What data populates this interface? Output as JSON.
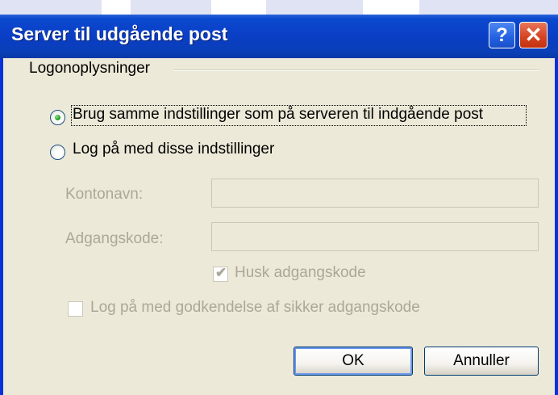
{
  "window": {
    "title": "Server til udgående post",
    "help_glyph": "?",
    "close_glyph": "✕"
  },
  "group": {
    "label": "Logonoplysninger"
  },
  "radios": [
    {
      "label": "Brug samme indstillinger som på serveren til indgående post",
      "selected": true
    },
    {
      "label": "Log på med disse indstillinger",
      "selected": false
    }
  ],
  "fields": {
    "account_label": "Kontonavn:",
    "account_value": "",
    "password_label": "Adgangskode:",
    "password_value": ""
  },
  "checkboxes": {
    "remember_password_label": "Husk adgangskode",
    "remember_password_checked": true,
    "spa_label": "Log på med godkendelse af sikker adgangskode",
    "spa_checked": false
  },
  "buttons": {
    "ok": "OK",
    "cancel": "Annuller"
  },
  "colors": {
    "titlebar": "#0a3ec5",
    "dialog_bg": "#ece9d8",
    "disabled_text": "#aca899",
    "radio_dot": "#21a121"
  }
}
